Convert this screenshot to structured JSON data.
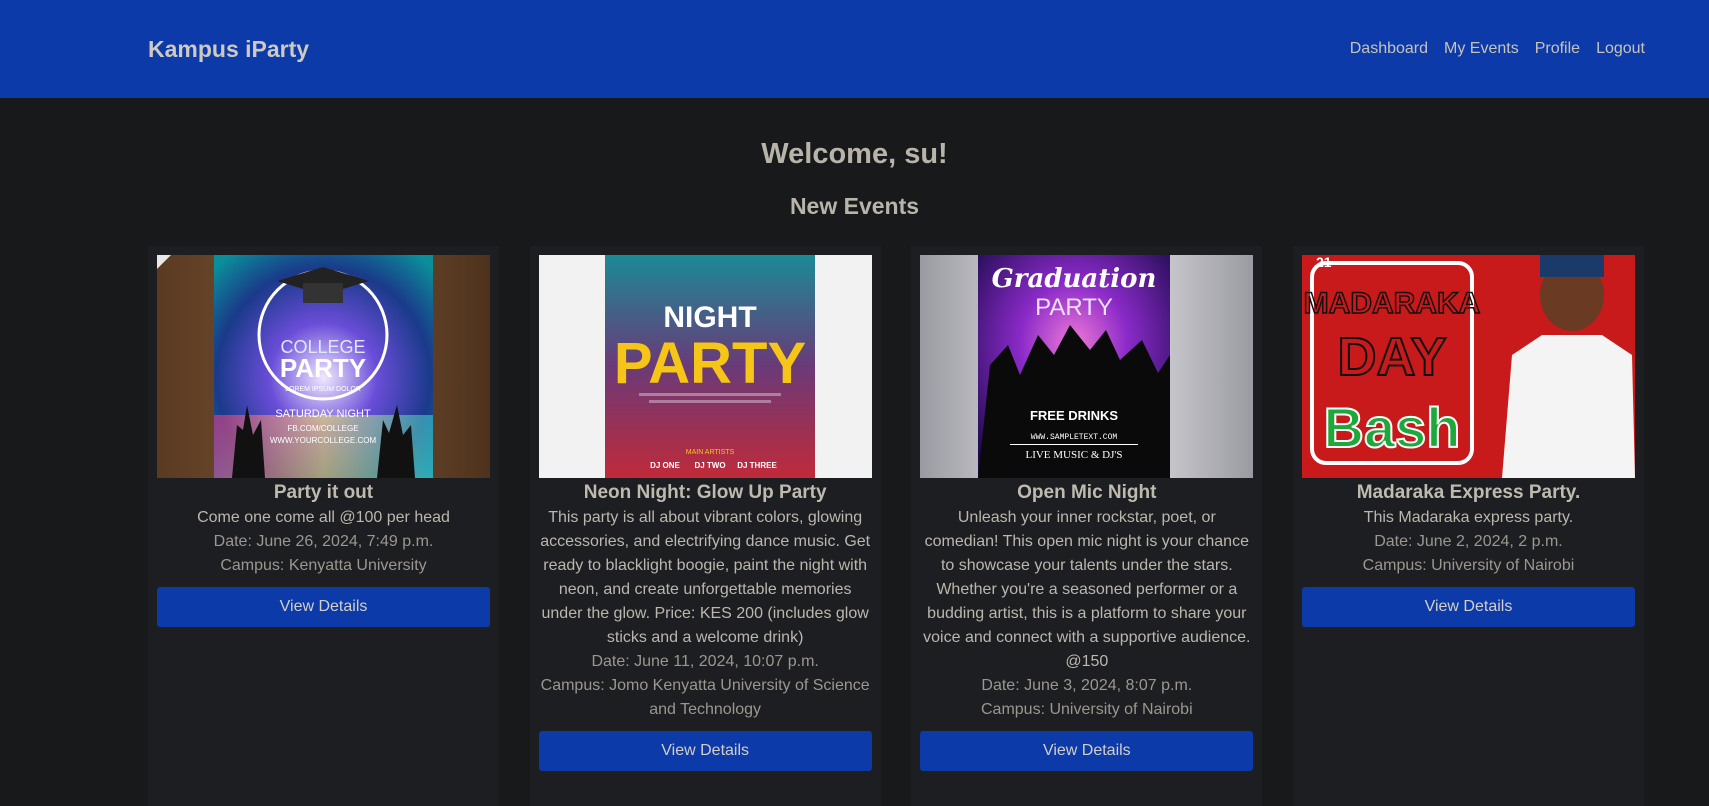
{
  "nav": {
    "brand": "Kampus iParty",
    "links": [
      "Dashboard",
      "My Events",
      "Profile",
      "Logout"
    ]
  },
  "welcome": "Welcome, su!",
  "section_title": "New Events",
  "events": [
    {
      "title": "Party it out",
      "description": "Come one come all @100 per head",
      "date": "Date: June 26, 2024, 7:49 p.m.",
      "campus": "Campus: Kenyatta University",
      "button": "View Details",
      "poster": {
        "line1": "COLLEGE",
        "line2": "PARTY",
        "line3": "LOREM IPSUM DOLOR",
        "line4": "SATURDAY NIGHT",
        "line5": "FB.COM/COLLEGE",
        "line6": "WWW.YOURCOLLEGE.COM"
      }
    },
    {
      "title": "Neon Night: Glow Up Party",
      "description": "This party is all about vibrant colors, glowing accessories, and electrifying dance music. Get ready to blacklight boogie, paint the night with neon, and create unforgettable memories under the glow. Price: KES 200 (includes glow sticks and a welcome drink)",
      "date": "Date: June 11, 2024, 10:07 p.m.",
      "campus": "Campus: Jomo Kenyatta University of Science and Technology",
      "button": "View Details",
      "poster": {
        "line1": "NIGHT",
        "line2": "PARTY",
        "line3": "MAIN ARTISTS",
        "line4": "DJ ONE",
        "line5": "DJ TWO",
        "line6": "DJ THREE"
      }
    },
    {
      "title": "Open Mic Night",
      "description": "Unleash your inner rockstar, poet, or comedian! This open mic night is your chance to showcase your talents under the stars. Whether you're a seasoned performer or a budding artist, this is a platform to share your voice and connect with a supportive audience. @150",
      "date": "Date: June 3, 2024, 8:07 p.m.",
      "campus": "Campus: University of Nairobi",
      "button": "View Details",
      "poster": {
        "line1": "Graduation",
        "line2": "PARTY",
        "line3": "FREE DRINKS",
        "line4": "WWW.SAMPLETEXT.COM",
        "line5": "LIVE MUSIC & DJ'S"
      }
    },
    {
      "title": "Madaraka Express Party.",
      "description": "This Madaraka express party.",
      "date": "Date: June 2, 2024, 2 p.m.",
      "campus": "Campus: University of Nairobi",
      "button": "View Details",
      "poster": {
        "line1": "21",
        "line2": "MADARAKA",
        "line3": "DAY",
        "line4": "Bash"
      }
    }
  ],
  "colors": {
    "navbar": "#0c3aa8",
    "background": "#18191b",
    "card": "#1c1e21",
    "button": "#0c3aa8"
  }
}
